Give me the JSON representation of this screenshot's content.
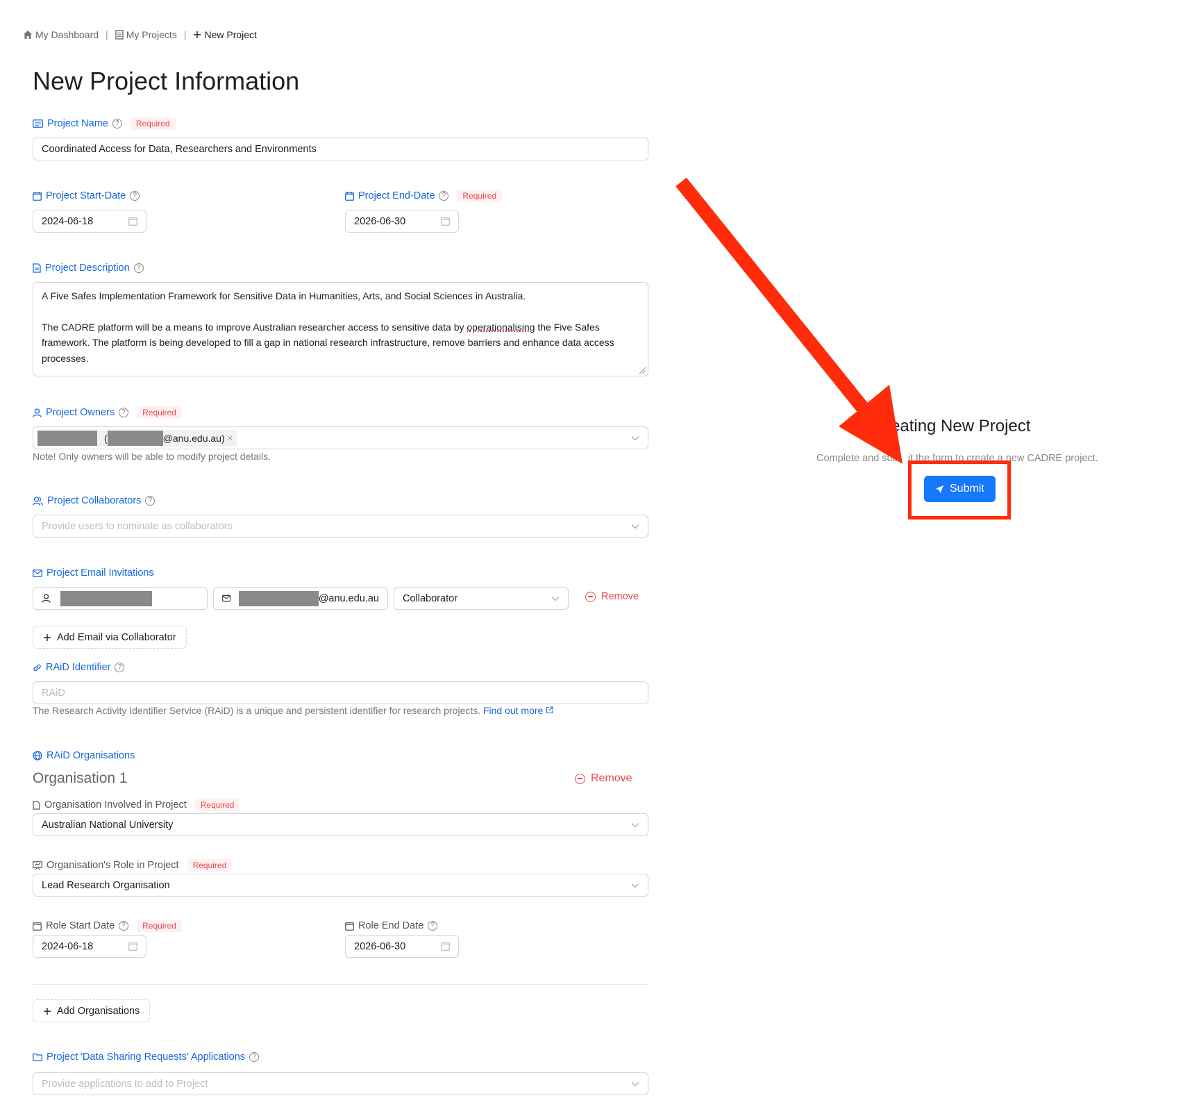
{
  "breadcrumb": {
    "dashboard": "My Dashboard",
    "projects": "My Projects",
    "new_project": "New Project",
    "separator": "|"
  },
  "page_title": "New Project Information",
  "required_tag": "Required",
  "project_name": {
    "label": "Project Name",
    "value": "Coordinated Access for Data, Researchers and Environments"
  },
  "start_date": {
    "label": "Project Start-Date",
    "value": "2024-06-18"
  },
  "end_date": {
    "label": "Project End-Date",
    "value": "2026-06-30"
  },
  "description": {
    "label": "Project Description",
    "para1": "A Five Safes Implementation Framework for Sensitive Data in Humanities, Arts, and Social Sciences in Australia.",
    "para2_a": "The CADRE platform will be a means to improve Australian researcher access to sensitive data by ",
    "para2_spell": "operationalising",
    "para2_b": " the Five Safes framework. The platform is being developed to fill a gap in national research infrastructure, remove barriers and enhance data access processes."
  },
  "owners": {
    "label": "Project Owners",
    "tag_open": "(",
    "tag_email_suffix": "@anu.edu.au)",
    "note": "Note! Only owners will be able to modify project details."
  },
  "collaborators": {
    "label": "Project Collaborators",
    "placeholder": "Provide users to nominate as collaborators"
  },
  "email_invites": {
    "label": "Project Email Invitations",
    "email_suffix": "@anu.edu.au",
    "role": "Collaborator",
    "remove": "Remove",
    "add_button": "Add Email via Collaborator"
  },
  "raid": {
    "label": "RAiD Identifier",
    "placeholder": "RAiD",
    "help": "The Research Activity Identifier Service (RAiD) is a unique and persistent identifier for research projects.",
    "help_link": "Find out more"
  },
  "raid_orgs": {
    "label": "RAiD Organisations",
    "org_title": "Organisation 1",
    "remove": "Remove",
    "org_label": "Organisation Involved in Project",
    "org_value": "Australian National University",
    "role_label": "Organisation's Role in Project",
    "role_value": "Lead Research Organisation",
    "role_start_label": "Role Start Date",
    "role_start_value": "2024-06-18",
    "role_end_label": "Role End Date",
    "role_end_value": "2026-06-30",
    "add_button": "Add Organisations"
  },
  "dsr": {
    "label": "Project 'Data Sharing Requests' Applications",
    "placeholder": "Provide applications to add to Project"
  },
  "side_panel": {
    "title": "eating New Project",
    "subtitle_a": "Complete and sub",
    "subtitle_b": "it the form to create a new CADRE project.",
    "submit": "Submit"
  },
  "colors": {
    "primary": "#1677ff",
    "label_blue": "#1668dc",
    "danger": "#e5484d",
    "annotation_red": "#ff2b0a"
  }
}
